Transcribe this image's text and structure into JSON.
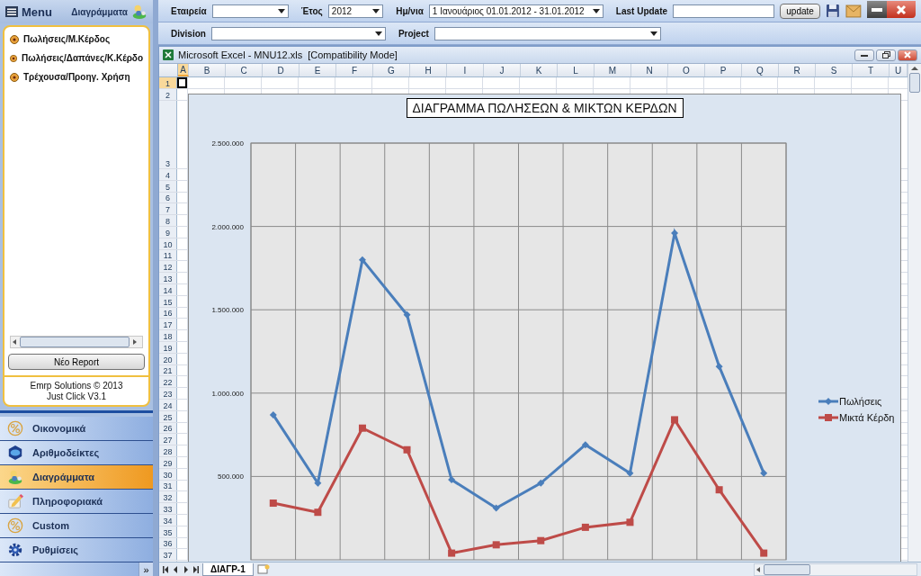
{
  "sidebar": {
    "title": "Menu",
    "section": "Διαγράμματα",
    "reports": [
      {
        "label": "Πωλήσεις/Μ.Κέρδος"
      },
      {
        "label": "Πωλήσεις/Δαπάνες/Κ.Κέρδο"
      },
      {
        "label": "Τρέχουσα/Προηγ. Χρήση"
      }
    ],
    "new_report_button": "Νέο Report",
    "footer": [
      "Emrp Solutions © 2013",
      "Just Click V3.1"
    ],
    "nav": [
      {
        "label": "Οικονομικά",
        "kind": "percent",
        "selected": false
      },
      {
        "label": "Αριθμοδείκτες",
        "kind": "hexagon",
        "selected": false
      },
      {
        "label": "Διαγράμματα",
        "kind": "figure",
        "selected": true
      },
      {
        "label": "Πληροφοριακά",
        "kind": "pencil",
        "selected": false
      },
      {
        "label": "Custom",
        "kind": "percent",
        "selected": false
      },
      {
        "label": "Ρυθμίσεις",
        "kind": "gear",
        "selected": false
      }
    ],
    "more_button": "»"
  },
  "toolbar": {
    "company": {
      "label": "Εταιρεία"
    },
    "year": {
      "label": "Έτος",
      "value": "2012"
    },
    "period": {
      "label": "Ημ/νια",
      "value": "1 Ιανουάριος 01.01.2012 - 31.01.2012"
    },
    "last_update": {
      "label": "Last Update"
    },
    "update_button": "update",
    "division": {
      "label": "Division"
    },
    "project": {
      "label": "Project"
    }
  },
  "excel": {
    "title": "Microsoft Excel - MNU12.xls  [Compatibility Mode]",
    "columns": [
      {
        "label": "A",
        "selected": true
      },
      {
        "label": "B",
        "selected": false
      },
      {
        "label": "C",
        "selected": false
      },
      {
        "label": "D",
        "selected": false
      },
      {
        "label": "E",
        "selected": false
      },
      {
        "label": "F",
        "selected": false
      },
      {
        "label": "G",
        "selected": false
      },
      {
        "label": "H",
        "selected": false
      },
      {
        "label": "I",
        "selected": false
      },
      {
        "label": "J",
        "selected": false
      },
      {
        "label": "K",
        "selected": false
      },
      {
        "label": "L",
        "selected": false
      },
      {
        "label": "M",
        "selected": false
      },
      {
        "label": "N",
        "selected": false
      },
      {
        "label": "O",
        "selected": false
      },
      {
        "label": "P",
        "selected": false
      },
      {
        "label": "Q",
        "selected": false
      },
      {
        "label": "R",
        "selected": false
      },
      {
        "label": "S",
        "selected": false
      },
      {
        "label": "T",
        "selected": false
      },
      {
        "label": "U",
        "selected": false
      }
    ],
    "rows": [
      {
        "label": "1",
        "selected": true
      },
      {
        "label": "2",
        "selected": false
      },
      {
        "label": "3",
        "selected": false
      },
      {
        "label": "4",
        "selected": false
      },
      {
        "label": "5",
        "selected": false
      },
      {
        "label": "6",
        "selected": false
      },
      {
        "label": "7",
        "selected": false
      },
      {
        "label": "8",
        "selected": false
      },
      {
        "label": "9",
        "selected": false
      },
      {
        "label": "10",
        "selected": false
      },
      {
        "label": "11",
        "selected": false
      },
      {
        "label": "12",
        "selected": false
      },
      {
        "label": "13",
        "selected": false
      },
      {
        "label": "14",
        "selected": false
      },
      {
        "label": "15",
        "selected": false
      },
      {
        "label": "16",
        "selected": false
      },
      {
        "label": "17",
        "selected": false
      },
      {
        "label": "18",
        "selected": false
      },
      {
        "label": "19",
        "selected": false
      },
      {
        "label": "20",
        "selected": false
      },
      {
        "label": "21",
        "selected": false
      },
      {
        "label": "22",
        "selected": false
      },
      {
        "label": "23",
        "selected": false
      },
      {
        "label": "24",
        "selected": false
      },
      {
        "label": "25",
        "selected": false
      },
      {
        "label": "26",
        "selected": false
      },
      {
        "label": "27",
        "selected": false
      },
      {
        "label": "28",
        "selected": false
      },
      {
        "label": "29",
        "selected": false
      },
      {
        "label": "30",
        "selected": false
      },
      {
        "label": "31",
        "selected": false
      },
      {
        "label": "32",
        "selected": false
      },
      {
        "label": "33",
        "selected": false
      },
      {
        "label": "34",
        "selected": false
      },
      {
        "label": "35",
        "selected": false
      },
      {
        "label": "36",
        "selected": false
      },
      {
        "label": "37",
        "selected": false
      }
    ],
    "chart": {
      "chart_data": {
        "type": "line",
        "grid": true,
        "legend": true,
        "title": "ΔΙΑΓΡΑΜΜΑ ΠΩΛΗΣΕΩΝ & ΜΙΚΤΩΝ ΚΕΡΔΩΝ",
        "ylim": [
          0,
          2500000
        ],
        "yticks": [
          {
            "value": 500000,
            "label": "500.000"
          },
          {
            "value": 1000000,
            "label": "1.000.000"
          },
          {
            "value": 1500000,
            "label": "1.500.000"
          },
          {
            "value": 2000000,
            "label": "2.000.000"
          },
          {
            "value": 2500000,
            "label": "2.500.000"
          }
        ],
        "series": [
          {
            "name": "Πωλήσεις",
            "color": "#4a7ebb",
            "marker": "diamond",
            "values": [
              870000,
              460000,
              1800000,
              1470000,
              480000,
              310000,
              460000,
              690000,
              520000,
              1960000,
              1160000,
              520000
            ]
          },
          {
            "name": "Μικτά Κέρδη",
            "color": "#be4b48",
            "marker": "square",
            "values": [
              340000,
              285000,
              790000,
              660000,
              40000,
              90000,
              115000,
              195000,
              225000,
              840000,
              420000,
              40000
            ]
          }
        ]
      }
    },
    "sheet_tabs": [
      {
        "label": "ΔΙΑΓΡ-1",
        "selected": true
      }
    ]
  }
}
